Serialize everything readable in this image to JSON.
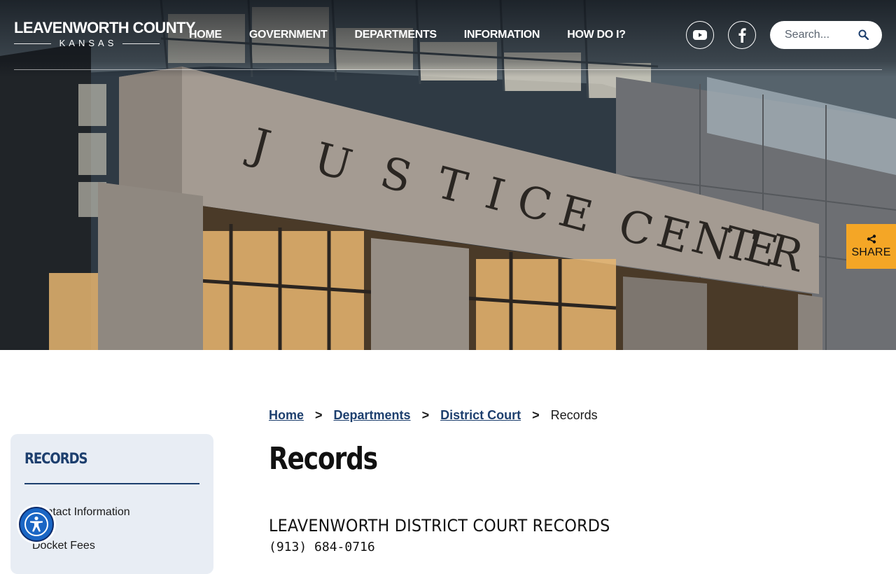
{
  "logo": {
    "line1": "LEAVENWORTH COUNTY",
    "line2": "KANSAS"
  },
  "nav": {
    "items": [
      {
        "label": "HOME"
      },
      {
        "label": "GOVERNMENT"
      },
      {
        "label": "DEPARTMENTS"
      },
      {
        "label": "INFORMATION"
      },
      {
        "label": "HOW DO I?"
      }
    ]
  },
  "social": {
    "youtube_icon": "youtube-icon",
    "facebook_icon": "facebook-icon"
  },
  "search": {
    "placeholder": "Search...",
    "icon": "search-icon"
  },
  "hero": {
    "building_sign": "JUSTICE CENTER"
  },
  "share": {
    "label": "SHARE",
    "icon": "share-icon"
  },
  "sidebar": {
    "title": "RECORDS",
    "links": [
      {
        "label": "Contact Information"
      },
      {
        "label": "Docket Fees"
      }
    ]
  },
  "accessibility": {
    "icon": "accessibility-icon"
  },
  "breadcrumb": {
    "items": [
      {
        "label": "Home"
      },
      {
        "label": "Departments"
      },
      {
        "label": "District Court"
      }
    ],
    "current": "Records",
    "separator": ">"
  },
  "main": {
    "title": "Records",
    "section_heading": "LEAVENWORTH DISTRICT COURT RECORDS",
    "phone": "(913) 684-0716"
  },
  "colors": {
    "navy": "#1d3f6e",
    "share_orange": "#f4a626",
    "sidebar_bg": "#e8edf4",
    "accessibility_blue": "#1a66c4"
  }
}
